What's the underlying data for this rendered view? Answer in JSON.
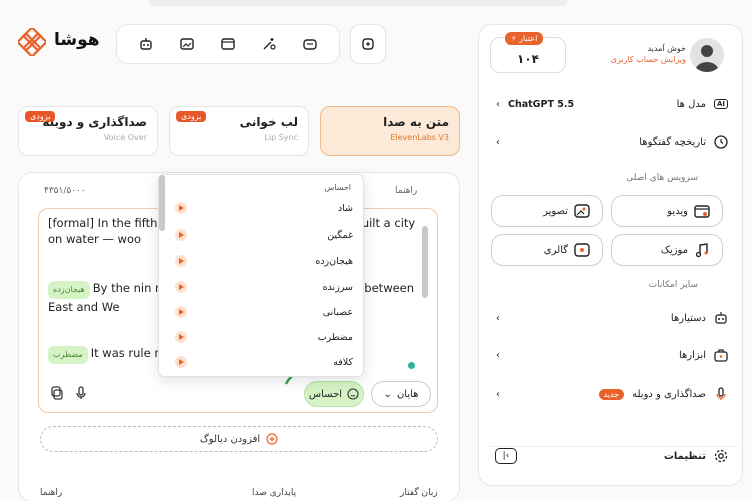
{
  "brand": {
    "name": "هوشا"
  },
  "toolbar": {
    "icons": [
      "robot-icon",
      "image-edit-icon",
      "video-icon",
      "magic-icon",
      "tv-icon"
    ],
    "extension_icon": "plugin-icon"
  },
  "modes": [
    {
      "title": "صداگذاری و دوبله",
      "subtitle": "Voice Over",
      "badge": "بزودی"
    },
    {
      "title": "لب خوانی",
      "subtitle": "Lip Sync",
      "badge": "بزودی"
    },
    {
      "title": "متن به صدا",
      "subtitle": "ElevenLabs V3",
      "badge": ""
    }
  ],
  "editor": {
    "counter": "۴۳۵۱/۵۰۰۰",
    "guide": "راهنما",
    "para1": "[formal] In the fifth ce                      to the marshes of northern                      ey built a city on water — woo",
    "para2_tag": "هیجان‌زده",
    "para2": "By the nin                      ne power. Its ships commanded                      ces between East and We",
    "para3_tag": "مضطرب",
    "para3": "It was rule                      r a thousand years."
  },
  "buttons": {
    "voice_label": "هایان",
    "emotion_label": "احساس",
    "add_dialog": "افزودن دیالوگ"
  },
  "dropdown": {
    "title": "احساس",
    "items": [
      "شاد",
      "غمگین",
      "هیجان‌زده",
      "سرزنده",
      "عصبانی",
      "مضطرب",
      "کلافه"
    ]
  },
  "bottom_labels": {
    "speech_lang": "زبان گفتار",
    "voice_stability": "پایداری صدا",
    "guide": "راهنما"
  },
  "sidebar": {
    "credit_label": "اعتبار",
    "credit_value": "۱۰۴",
    "welcome": "خوش آمدید",
    "edit_account": "ویرایش حساب کاربری",
    "models_label": "مدل ها",
    "models_value": "ChatGPT 5.5",
    "history_label": "تاریخچه گفتگوها",
    "main_services": "سرویس های اصلی",
    "services": [
      "ویدیو",
      "تصویر",
      "موزیک",
      "گالری"
    ],
    "other_features": "سایر امکانات",
    "assistants": "دستیارها",
    "tools": "ابزارها",
    "dubbing": "صداگذاری و دوبله",
    "new_badge": "جدید",
    "settings": "تنظیمات"
  },
  "colors": {
    "accent": "#e8632c",
    "badge": "#e8572a",
    "teal": "#2fb39a",
    "green_btn": "#d6f3c5"
  }
}
